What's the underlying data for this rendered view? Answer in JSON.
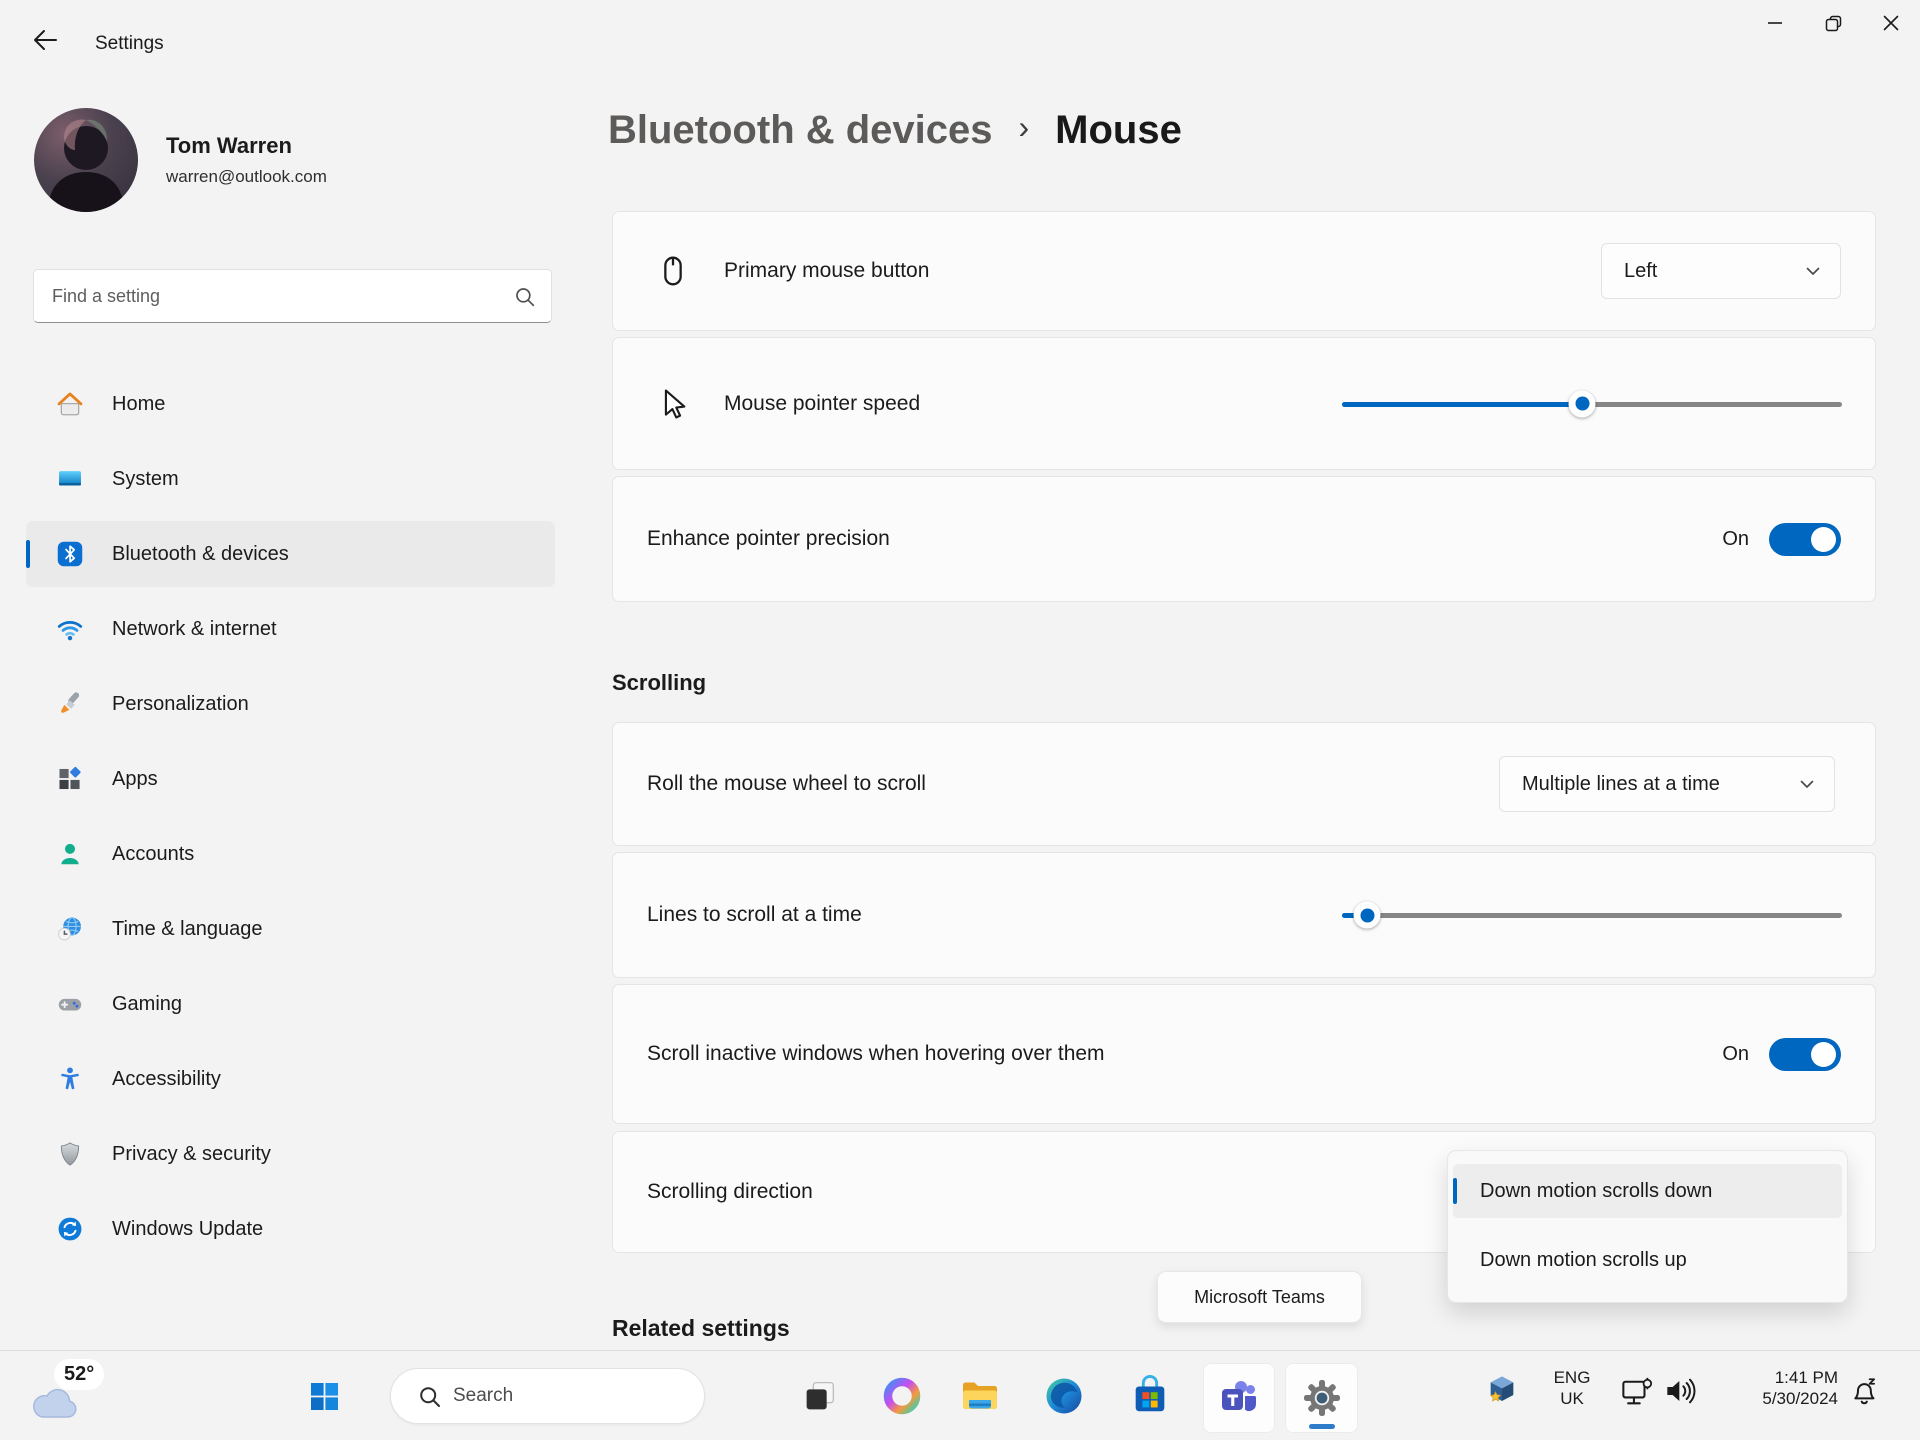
{
  "window": {
    "title": "Settings"
  },
  "account": {
    "name": "Tom Warren",
    "email": "warren@outlook.com"
  },
  "sidebar": {
    "search_placeholder": "Find a setting",
    "items": [
      {
        "label": "Home",
        "icon": "home-icon",
        "selected": false
      },
      {
        "label": "System",
        "icon": "system-icon",
        "selected": false
      },
      {
        "label": "Bluetooth & devices",
        "icon": "bluetooth-icon",
        "selected": true
      },
      {
        "label": "Network & internet",
        "icon": "network-icon",
        "selected": false
      },
      {
        "label": "Personalization",
        "icon": "personalization-icon",
        "selected": false
      },
      {
        "label": "Apps",
        "icon": "apps-icon",
        "selected": false
      },
      {
        "label": "Accounts",
        "icon": "accounts-icon",
        "selected": false
      },
      {
        "label": "Time & language",
        "icon": "time-language-icon",
        "selected": false
      },
      {
        "label": "Gaming",
        "icon": "gaming-icon",
        "selected": false
      },
      {
        "label": "Accessibility",
        "icon": "accessibility-icon",
        "selected": false
      },
      {
        "label": "Privacy & security",
        "icon": "privacy-icon",
        "selected": false
      },
      {
        "label": "Windows Update",
        "icon": "windows-update-icon",
        "selected": false
      }
    ]
  },
  "breadcrumb": {
    "parent": "Bluetooth & devices",
    "separator": "›",
    "current": "Mouse"
  },
  "content": {
    "primary_mouse_button": {
      "label": "Primary mouse button",
      "value": "Left"
    },
    "pointer_speed": {
      "label": "Mouse pointer speed",
      "percent": 48
    },
    "enhance_precision": {
      "label": "Enhance pointer precision",
      "state": "On"
    },
    "scrolling_heading": "Scrolling",
    "wheel_scroll": {
      "label": "Roll the mouse wheel to scroll",
      "value": "Multiple lines at a time"
    },
    "lines_to_scroll": {
      "label": "Lines to scroll at a time",
      "percent": 5
    },
    "scroll_inactive": {
      "label": "Scroll inactive windows when hovering over them",
      "state": "On"
    },
    "scrolling_direction": {
      "label": "Scrolling direction"
    },
    "related_settings_heading": "Related settings"
  },
  "flyout": {
    "options": [
      "Down motion scrolls down",
      "Down motion scrolls up"
    ],
    "selected_index": 0
  },
  "tooltip": {
    "teams": "Microsoft Teams"
  },
  "taskbar": {
    "weather_temp": "52°",
    "search_placeholder": "Search",
    "tray": {
      "language_top": "ENG",
      "language_bottom": "UK",
      "time": "1:41 PM",
      "date": "5/30/2024"
    }
  },
  "colors": {
    "accent": "#0067c0",
    "page_bg": "#f3f3f3",
    "card_bg": "#fbfbfb",
    "card_border": "#e5e5e5",
    "selected_bg": "#eaeaea",
    "text_primary": "#1b1b1b",
    "text_secondary": "#5e5c5a",
    "taskbar_bg": "#f3f3f3"
  }
}
